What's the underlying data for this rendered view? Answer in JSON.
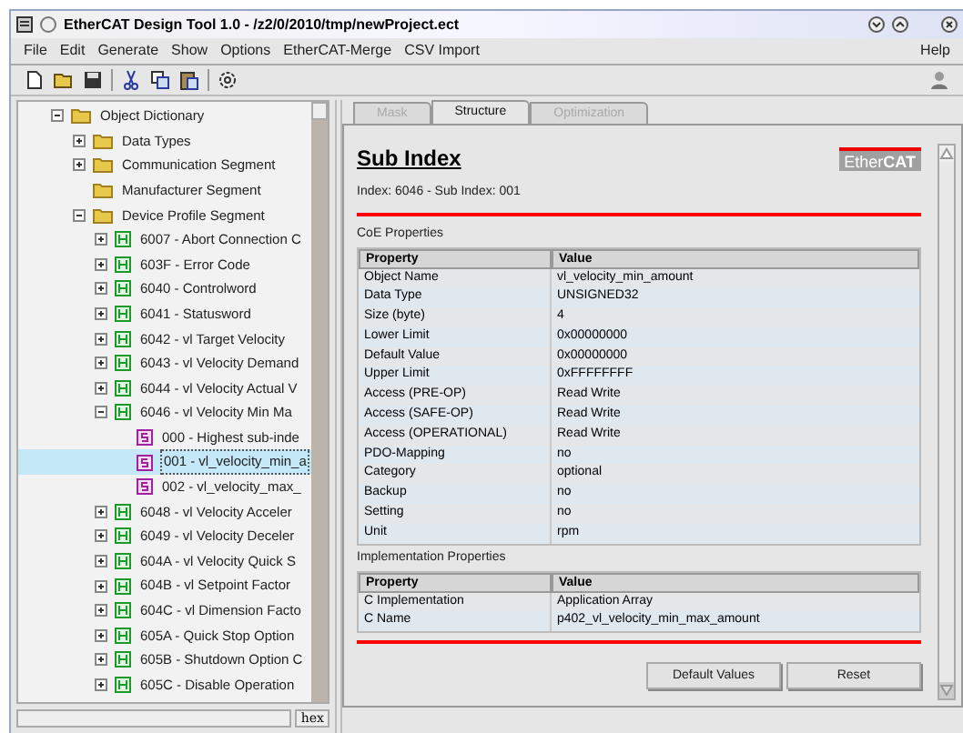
{
  "window": {
    "title": "EtherCAT Design Tool 1.0 - /z2/0/2010/tmp/newProject.ect"
  },
  "menu": [
    {
      "label": "File"
    },
    {
      "label": "Edit"
    },
    {
      "label": "Generate"
    },
    {
      "label": "Show"
    },
    {
      "label": "Options"
    },
    {
      "label": "EtherCAT-Merge"
    },
    {
      "label": "CSV Import"
    }
  ],
  "help_menu": "Help",
  "tree": [
    {
      "kind": "folder",
      "label": "Object Dictionary",
      "expanded": true,
      "selected": false,
      "children": [
        {
          "kind": "folder",
          "label": "Data Types",
          "expanded": false,
          "selected": false
        },
        {
          "kind": "folder",
          "label": "Communication Segment",
          "expanded": false,
          "selected": false
        },
        {
          "kind": "folder",
          "label": "Manufacturer Segment",
          "selected": false
        },
        {
          "kind": "folder",
          "label": "Device Profile Segment",
          "expanded": true,
          "selected": false,
          "children": [
            {
              "kind": "object",
              "label": "6007 - Abort Connection C",
              "expanded": false,
              "selected": false
            },
            {
              "kind": "object",
              "label": "603F - Error Code",
              "expanded": false,
              "selected": false
            },
            {
              "kind": "object",
              "label": "6040 - Controlword",
              "expanded": false,
              "selected": false
            },
            {
              "kind": "object",
              "label": "6041 - Statusword",
              "expanded": false,
              "selected": false
            },
            {
              "kind": "object",
              "label": "6042 - vl Target Velocity",
              "expanded": false,
              "selected": false
            },
            {
              "kind": "object",
              "label": "6043 - vl Velocity Demand",
              "expanded": false,
              "selected": false
            },
            {
              "kind": "object",
              "label": "6044 - vl Velocity Actual V",
              "expanded": false,
              "selected": false
            },
            {
              "kind": "object",
              "label": "6046 - vl Velocity Min Ma",
              "expanded": true,
              "selected": false,
              "children": [
                {
                  "kind": "subindex",
                  "label": "000 - Highest sub-inde",
                  "selected": false
                },
                {
                  "kind": "subindex",
                  "label": "001 - vl_velocity_min_a",
                  "selected": true
                },
                {
                  "kind": "subindex",
                  "label": "002 - vl_velocity_max_",
                  "selected": false
                }
              ]
            },
            {
              "kind": "object",
              "label": "6048 - vl Velocity Acceler",
              "expanded": false,
              "selected": false
            },
            {
              "kind": "object",
              "label": "6049 - vl Velocity Deceler",
              "expanded": false,
              "selected": false
            },
            {
              "kind": "object",
              "label": "604A - vl Velocity Quick S",
              "expanded": false,
              "selected": false
            },
            {
              "kind": "object",
              "label": "604B - vl Setpoint Factor",
              "expanded": false,
              "selected": false
            },
            {
              "kind": "object",
              "label": "604C - vl Dimension Facto",
              "expanded": false,
              "selected": false
            },
            {
              "kind": "object",
              "label": "605A - Quick Stop Option",
              "expanded": false,
              "selected": false
            },
            {
              "kind": "object",
              "label": "605B - Shutdown Option C",
              "expanded": false,
              "selected": false
            },
            {
              "kind": "object",
              "label": "605C - Disable Operation",
              "expanded": false,
              "selected": false
            }
          ]
        }
      ]
    }
  ],
  "status_field": "hex",
  "tabs": [
    {
      "label": "Mask",
      "selected": false,
      "disabled": true
    },
    {
      "label": "Structure",
      "selected": true,
      "disabled": false
    },
    {
      "label": "Optimization",
      "selected": false,
      "disabled": true
    }
  ],
  "heading": "Sub Index",
  "logo": {
    "left": "Ether",
    "right": "CAT"
  },
  "subtitle": "Index: 6046 - Sub Index: 001",
  "sections": [
    {
      "title": "CoE Properties",
      "columns": [
        "Property",
        "Value"
      ],
      "rows": [
        [
          "Object Name",
          "vl_velocity_min_amount"
        ],
        [
          "Data Type",
          "UNSIGNED32"
        ],
        [
          "Size (byte)",
          "4"
        ],
        [
          "Lower Limit",
          "0x00000000"
        ],
        [
          "Default Value",
          "0x00000000"
        ],
        [
          "Upper Limit",
          "0xFFFFFFFF"
        ],
        [
          "Access (PRE-OP)",
          "Read Write"
        ],
        [
          "Access (SAFE-OP)",
          "Read Write"
        ],
        [
          "Access (OPERATIONAL)",
          "Read Write"
        ],
        [
          "PDO-Mapping",
          "no"
        ],
        [
          "Category",
          "optional"
        ],
        [
          "Backup",
          "no"
        ],
        [
          "Setting",
          "no"
        ],
        [
          "Unit",
          "rpm"
        ]
      ]
    },
    {
      "title": "Implementation Properties",
      "columns": [
        "Property",
        "Value"
      ],
      "rows": [
        [
          "C Implementation",
          "Application Array"
        ],
        [
          "C Name",
          "p402_vl_velocity_min_max_amount"
        ]
      ]
    }
  ],
  "buttons": [
    "Default Values",
    "Reset"
  ]
}
